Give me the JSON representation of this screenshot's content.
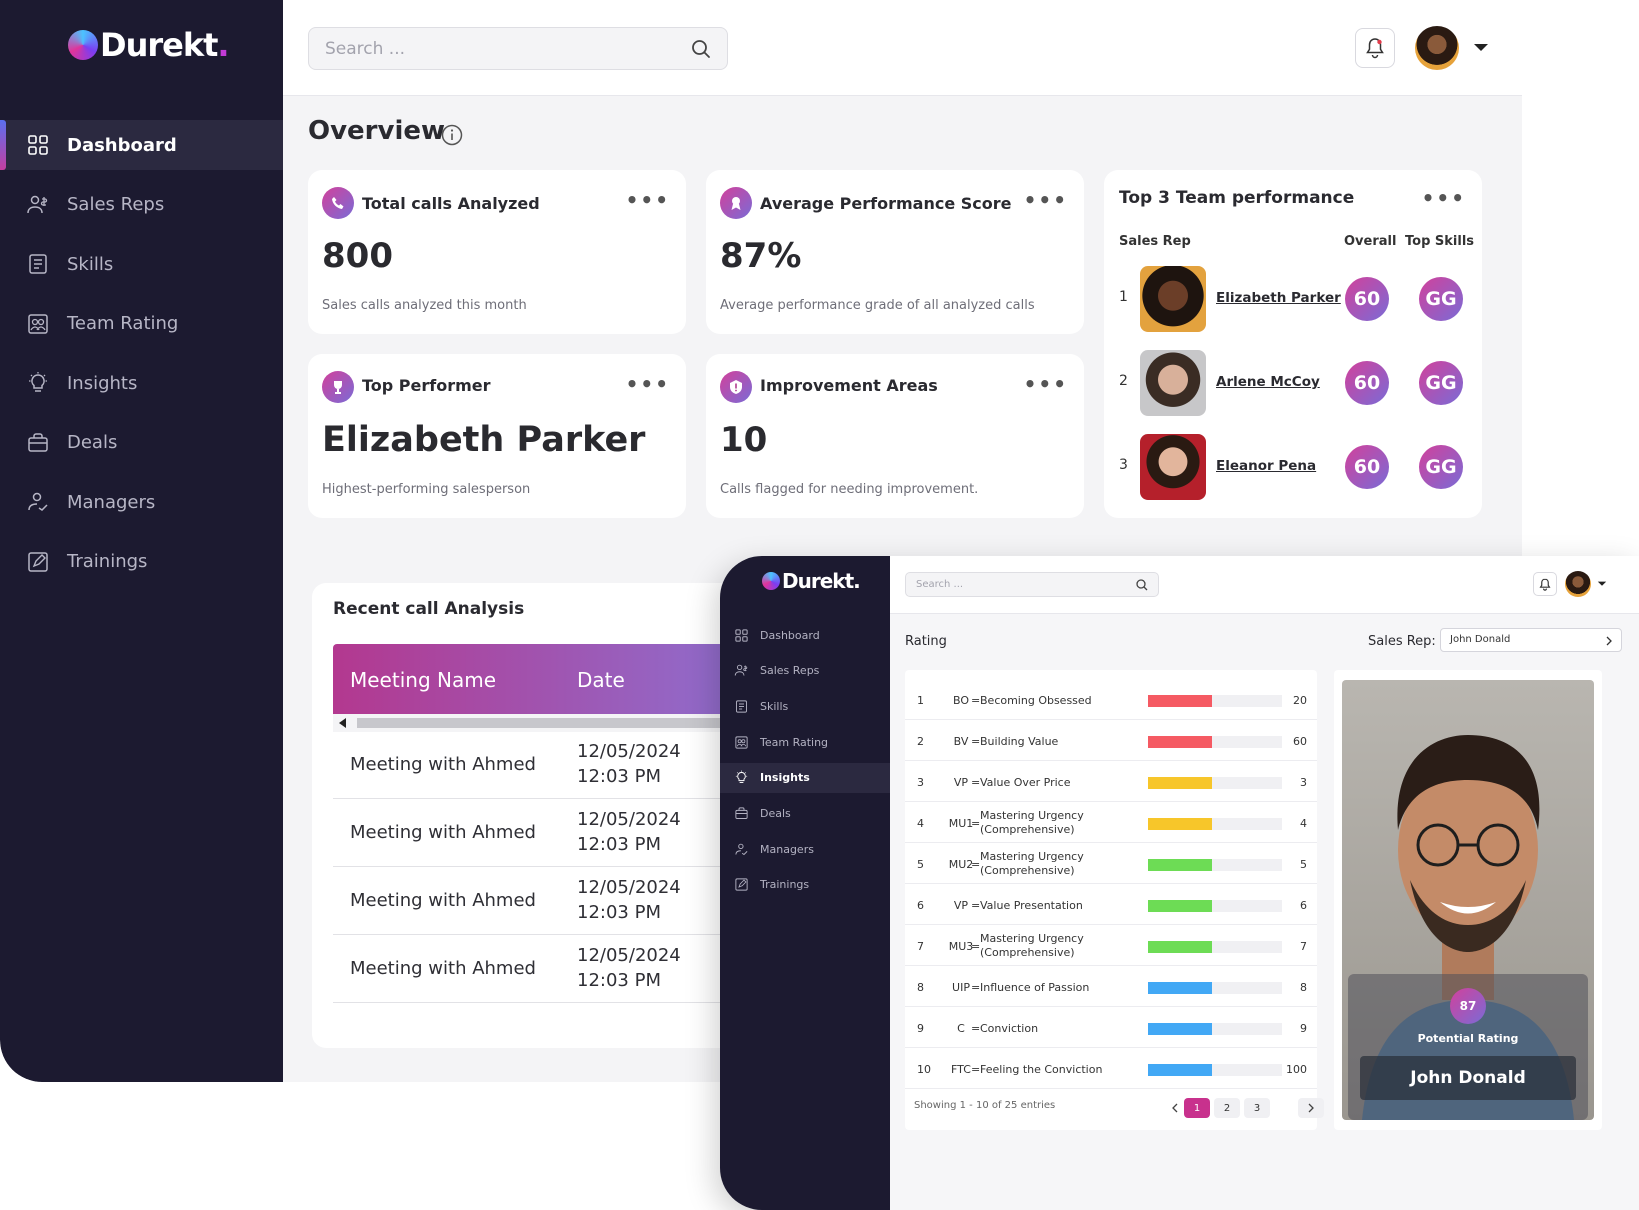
{
  "app": {
    "brand": "Durekt",
    "brand_dot": "."
  },
  "sidebar": {
    "items": [
      {
        "label": "Dashboard",
        "icon": "dashboard-grid-icon",
        "active": true
      },
      {
        "label": "Sales Reps",
        "icon": "users-dollar-icon"
      },
      {
        "label": "Skills",
        "icon": "clipboard-list-icon"
      },
      {
        "label": "Team Rating",
        "icon": "team-rating-icon"
      },
      {
        "label": "Insights",
        "icon": "lightbulb-icon"
      },
      {
        "label": "Deals",
        "icon": "briefcase-icon"
      },
      {
        "label": "Managers",
        "icon": "manager-icon"
      },
      {
        "label": "Trainings",
        "icon": "training-icon"
      }
    ]
  },
  "header": {
    "search_placeholder": "Search ..."
  },
  "overview": {
    "title": "Overview"
  },
  "cards": {
    "total_calls": {
      "title": "Total calls Analyzed",
      "value": "800",
      "sub": "Sales calls analyzed this month"
    },
    "avg_score": {
      "title": "Average Performance Score",
      "value": "87%",
      "sub": "Average performance grade of all analyzed calls"
    },
    "top_performer": {
      "title": "Top Performer",
      "value": "Elizabeth Parker",
      "sub": "Highest-performing salesperson"
    },
    "improvement": {
      "title": "Improvement Areas",
      "value": "10",
      "sub": "Calls flagged for needing improvement."
    },
    "dots": "•••"
  },
  "top3": {
    "title": "Top 3 Team performance",
    "col_rep": "Sales Rep",
    "col_overall": "Overall",
    "col_skills": "Top Skills",
    "rows": [
      {
        "rank": "1",
        "name": "Elizabeth Parker",
        "overall": "60",
        "skills": "GG"
      },
      {
        "rank": "2",
        "name": "Arlene McCoy",
        "overall": "60",
        "skills": "GG"
      },
      {
        "rank": "3",
        "name": "Eleanor Pena",
        "overall": "60",
        "skills": "GG"
      }
    ]
  },
  "recent": {
    "title": "Recent call Analysis",
    "col_name": "Meeting Name",
    "col_date": "Date",
    "rows": [
      {
        "name": "Meeting with Ahmed",
        "date": "12/05/2024",
        "time": "12:03 PM"
      },
      {
        "name": "Meeting with Ahmed",
        "date": "12/05/2024",
        "time": "12:03 PM"
      },
      {
        "name": "Meeting with Ahmed",
        "date": "12/05/2024",
        "time": "12:03 PM"
      },
      {
        "name": "Meeting with Ahmed",
        "date": "12/05/2024",
        "time": "12:03 PM"
      }
    ]
  },
  "insights": {
    "search_placeholder": "Search ...",
    "nav": [
      {
        "label": "Dashboard",
        "icon": "dashboard-grid-icon"
      },
      {
        "label": "Sales Reps",
        "icon": "users-dollar-icon"
      },
      {
        "label": "Skills",
        "icon": "clipboard-list-icon"
      },
      {
        "label": "Team Rating",
        "icon": "team-rating-icon"
      },
      {
        "label": "Insights",
        "icon": "lightbulb-icon",
        "active": true
      },
      {
        "label": "Deals",
        "icon": "briefcase-icon"
      },
      {
        "label": "Managers",
        "icon": "manager-icon"
      },
      {
        "label": "Trainings",
        "icon": "training-icon"
      }
    ],
    "rating_title": "Rating",
    "sales_rep_label": "Sales Rep:",
    "sales_rep_value": "John Donald",
    "rows": [
      {
        "n": "1",
        "abbr": "BO",
        "label": "Becoming Obsessed",
        "value": "20",
        "fill": 0.48,
        "color": "#f55a63"
      },
      {
        "n": "2",
        "abbr": "BV",
        "label": "Building Value",
        "value": "60",
        "fill": 0.48,
        "color": "#f55a63"
      },
      {
        "n": "3",
        "abbr": "VP",
        "label": "Value Over Price",
        "value": "3",
        "fill": 0.48,
        "color": "#f7c62a"
      },
      {
        "n": "4",
        "abbr": "MU1",
        "label": "Mastering Urgency (Comprehensive)",
        "value": "4",
        "fill": 0.48,
        "color": "#f7c62a"
      },
      {
        "n": "5",
        "abbr": "MU2",
        "label": "Mastering Urgency (Comprehensive)",
        "value": "5",
        "fill": 0.48,
        "color": "#6ddc55"
      },
      {
        "n": "6",
        "abbr": "VP",
        "label": "Value Presentation",
        "value": "6",
        "fill": 0.48,
        "color": "#6ddc55"
      },
      {
        "n": "7",
        "abbr": "MU3",
        "label": "Mastering Urgency (Comprehensive)",
        "value": "7",
        "fill": 0.48,
        "color": "#6ddc55"
      },
      {
        "n": "8",
        "abbr": "UIP",
        "label": "Influence of Passion",
        "value": "8",
        "fill": 0.48,
        "color": "#42a8f5"
      },
      {
        "n": "9",
        "abbr": "C",
        "label": "Conviction",
        "value": "9",
        "fill": 0.48,
        "color": "#42a8f5"
      },
      {
        "n": "10",
        "abbr": "FTC",
        "label": "Feeling the Conviction",
        "value": "100",
        "fill": 0.48,
        "color": "#42a8f5"
      }
    ],
    "showing": "Showing 1 - 10 of 25 entries",
    "pages": [
      "1",
      "2",
      "3"
    ],
    "profile": {
      "score": "87",
      "score_label": "Potential Rating",
      "name": "John Donald"
    }
  },
  "colors": {
    "sidebar": "#1c1a30",
    "accent_pink": "#c8318d",
    "accent_purple": "#7a6bd6"
  }
}
